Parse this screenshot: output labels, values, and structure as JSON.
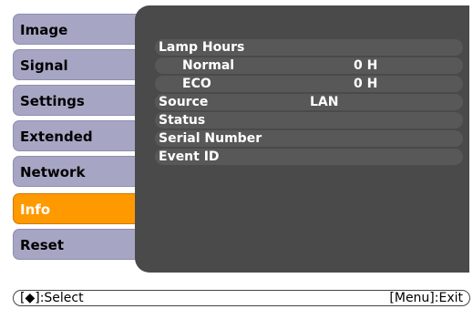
{
  "menu": {
    "items": [
      {
        "label": "Image"
      },
      {
        "label": "Signal"
      },
      {
        "label": "Settings"
      },
      {
        "label": "Extended"
      },
      {
        "label": "Network"
      },
      {
        "label": "Info"
      },
      {
        "label": "Reset"
      }
    ],
    "active_index": 5
  },
  "info": {
    "lamp_hours_label": "Lamp Hours",
    "normal_label": "Normal",
    "normal_value": "0 H",
    "eco_label": "ECO",
    "eco_value": "0 H",
    "source_label": "Source",
    "source_value": "LAN",
    "status_label": "Status",
    "serial_label": "Serial Number",
    "event_label": "Event ID"
  },
  "footer": {
    "left": "[◆]:Select",
    "right": "[Menu]:Exit"
  },
  "colors": {
    "active_tab": "#ff9900",
    "tab": "#a6a6c4",
    "panel": "#4a4a4a"
  }
}
